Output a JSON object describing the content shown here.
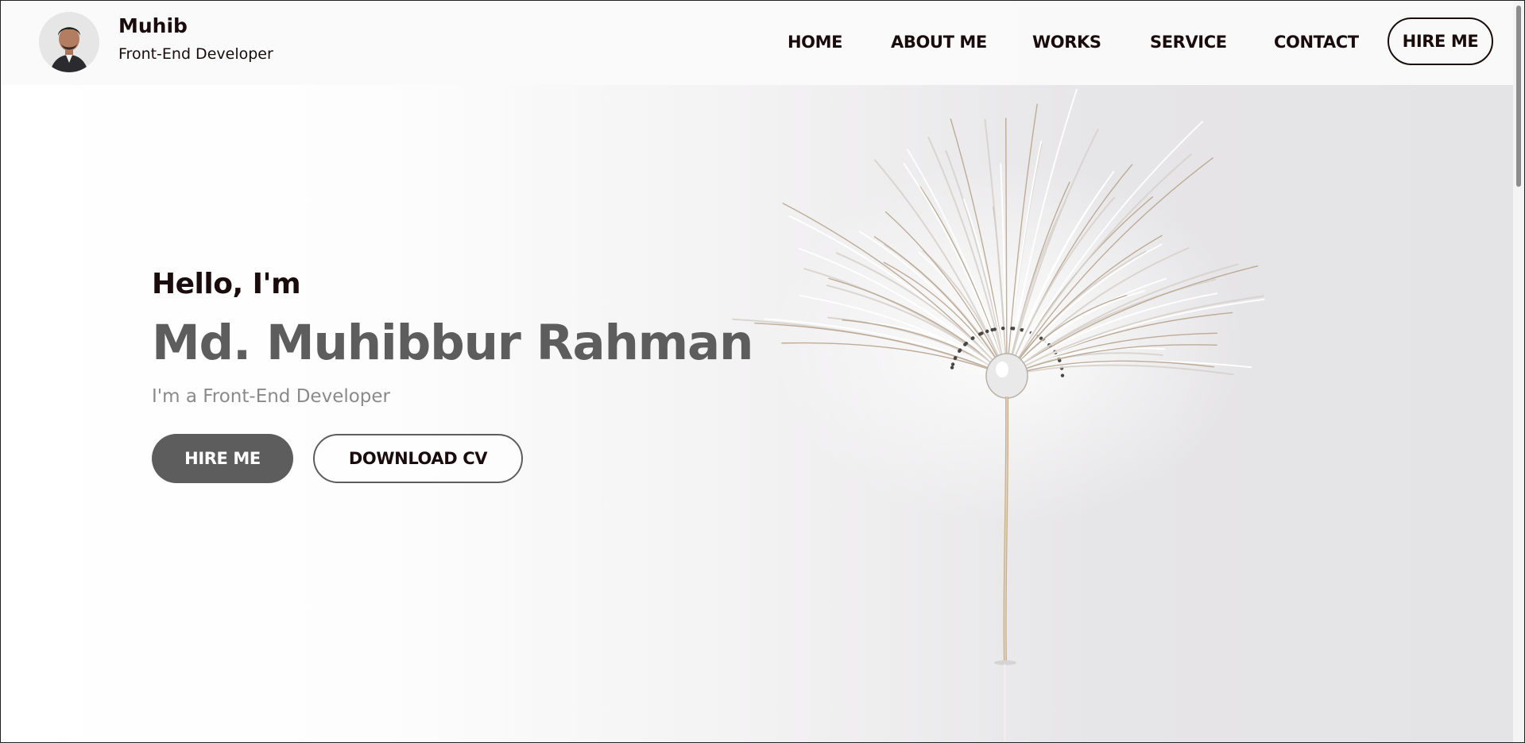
{
  "header": {
    "brand_name": "Muhib",
    "brand_subtitle": "Front-End Developer",
    "avatar_icon": "profile-photo",
    "nav_items": [
      {
        "label": "HOME"
      },
      {
        "label": "ABOUT ME"
      },
      {
        "label": "WORKS"
      },
      {
        "label": "SERVICE"
      },
      {
        "label": "CONTACT"
      }
    ],
    "hire_label": "HIRE ME"
  },
  "hero": {
    "greeting": "Hello, I'm",
    "name": "Md. Muhibbur Rahman",
    "role": "I'm a Front-End Developer",
    "primary_button": "HIRE ME",
    "secondary_button": "DOWNLOAD CV"
  },
  "colors": {
    "text_dark": "#1a0c0c",
    "accent_gray": "#5d5d5d",
    "muted_gray": "#8a8a8a"
  }
}
